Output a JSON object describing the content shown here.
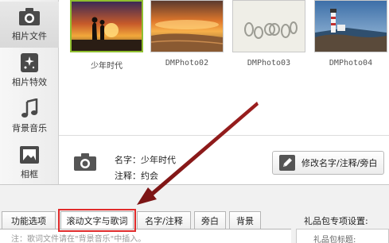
{
  "sidebar": {
    "items": [
      {
        "label": "相片文件",
        "icon": "camera-icon"
      },
      {
        "label": "相片特效",
        "icon": "sparkle-icon"
      },
      {
        "label": "背景音乐",
        "icon": "music-note-icon"
      },
      {
        "label": "相框",
        "icon": "picture-frame-icon"
      }
    ]
  },
  "photos": [
    {
      "name": "少年时代"
    },
    {
      "name": "DMPhoto02"
    },
    {
      "name": "DMPhoto03"
    },
    {
      "name": "DMPhoto04"
    }
  ],
  "info": {
    "name_line": "名字：少年时代",
    "note_line": "注释：约会",
    "edit_button_label": "修改名字/注释/旁白"
  },
  "tabs": [
    {
      "label": "功能选项"
    },
    {
      "label": "滚动文字与歌词"
    },
    {
      "label": "名字/注释"
    },
    {
      "label": "旁白"
    },
    {
      "label": "背景"
    }
  ],
  "tab_note": "注：歌词文件请在\"背景音乐\"中插入。",
  "gift": {
    "title": "礼品包专项设置:",
    "row_label": "礼品包标题:"
  },
  "colors": {
    "highlight": "#e02b2b",
    "arrow": "#8b1a1a",
    "selected_border": "#8fbf2f"
  }
}
